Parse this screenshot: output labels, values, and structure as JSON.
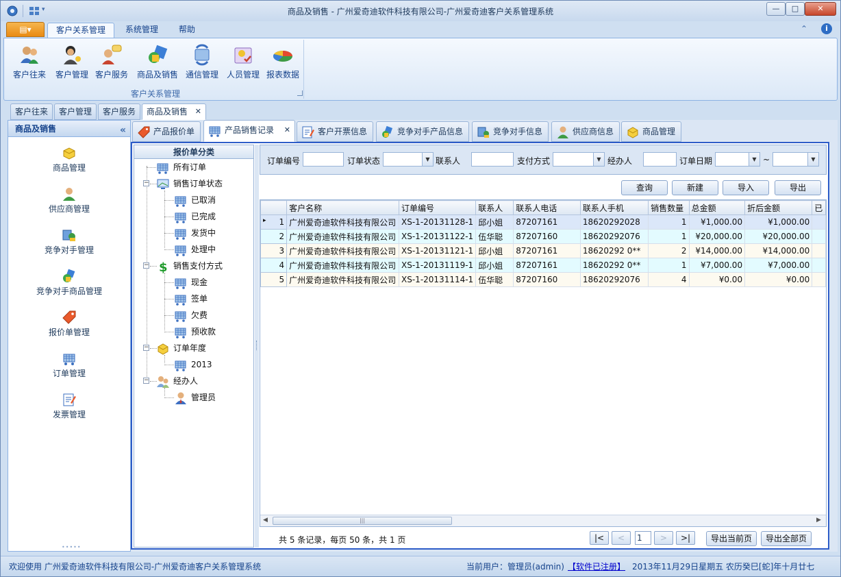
{
  "window": {
    "title": "商品及销售 - 广州爱奇迪软件科技有限公司-广州爱奇迪客户关系管理系统",
    "minimize": "—",
    "maximize": "□",
    "close": "✕"
  },
  "ribbon": {
    "app_menu": "▤▾",
    "tabs": [
      "客户关系管理",
      "系统管理",
      "帮助"
    ],
    "buttons": [
      "客户往来",
      "客户管理",
      "客户服务",
      "商品及销售",
      "通信管理",
      "人员管理",
      "报表数据"
    ],
    "group_label": "客户关系管理",
    "right_icons": [
      "⌃",
      "i"
    ]
  },
  "doc_tabs": [
    "客户往来",
    "客户管理",
    "客户服务",
    "商品及销售"
  ],
  "doc_close": "✕",
  "nav": {
    "title": "商品及销售",
    "collapse": "«",
    "items": [
      "商品管理",
      "供应商管理",
      "竞争对手管理",
      "竞争对手商品管理",
      "报价单管理",
      "订单管理",
      "发票管理"
    ],
    "grip": "•••••"
  },
  "inner_tabs": [
    "产品报价单",
    "产品销售记录",
    "客户开票信息",
    "竞争对手产品信息",
    "竞争对手信息",
    "供应商信息",
    "商品管理"
  ],
  "inner_close": "✕",
  "tree": {
    "title": "报价单分类",
    "nodes": {
      "all": "所有订单",
      "status": "销售订单状态",
      "s1": "已取消",
      "s2": "已完成",
      "s3": "发货中",
      "s4": "处理中",
      "pay": "销售支付方式",
      "p1": "现金",
      "p2": "签单",
      "p3": "欠费",
      "p4": "预收款",
      "year": "订单年度",
      "y1": "2013",
      "handler": "经办人",
      "h1": "管理员"
    },
    "minus": "−"
  },
  "filter": {
    "order_no": "订单编号",
    "order_status": "订单状态",
    "contact": "联系人",
    "pay_method": "支付方式",
    "handler": "经办人",
    "order_date": "订单日期",
    "tilde": "~",
    "arrow": "▼"
  },
  "actions": {
    "query": "查询",
    "new": "新建",
    "import": "导入",
    "export": "导出"
  },
  "grid": {
    "columns": [
      "客户名称",
      "订单编号",
      "联系人",
      "联系人电话",
      "联系人手机",
      "销售数量",
      "总金额",
      "折后金额",
      "已"
    ],
    "current_marker": "▸",
    "rows": [
      {
        "n": "1",
        "name": "广州爱奇迪软件科技有限公司",
        "no": "XS-1-20131128-1",
        "contact": "邱小姐",
        "tel": "87207161",
        "mobile": "18620292028",
        "qty": "1",
        "total": "¥1,000.00",
        "disc": "¥1,000.00"
      },
      {
        "n": "2",
        "name": "广州爱奇迪软件科技有限公司",
        "no": "XS-1-20131122-1",
        "contact": "伍华聪",
        "tel": "87207160",
        "mobile": "18620292076",
        "qty": "1",
        "total": "¥20,000.00",
        "disc": "¥20,000.00"
      },
      {
        "n": "3",
        "name": "广州爱奇迪软件科技有限公司",
        "no": "XS-1-20131121-1",
        "contact": "邱小姐",
        "tel": "87207161",
        "mobile": "18620292 0**",
        "qty": "2",
        "total": "¥14,000.00",
        "disc": "¥14,000.00"
      },
      {
        "n": "4",
        "name": "广州爱奇迪软件科技有限公司",
        "no": "XS-1-20131119-1",
        "contact": "邱小姐",
        "tel": "87207161",
        "mobile": "18620292 0**",
        "qty": "1",
        "total": "¥7,000.00",
        "disc": "¥7,000.00"
      },
      {
        "n": "5",
        "name": "广州爱奇迪软件科技有限公司",
        "no": "XS-1-20131114-1",
        "contact": "伍华聪",
        "tel": "87207160",
        "mobile": "18620292076",
        "qty": "4",
        "total": "¥0.00",
        "disc": "¥0.00"
      }
    ],
    "scroll_left": "◀",
    "scroll_right": "▶",
    "scroll_grip": "|||"
  },
  "pager": {
    "info": "共 5 条记录，每页 50 条，共 1 页",
    "first": "|<",
    "prev": "<",
    "page": "1",
    "next": ">",
    "last": ">|",
    "export_current": "导出当前页",
    "export_all": "导出全部页"
  },
  "status": {
    "welcome": "欢迎使用 广州爱奇迪软件科技有限公司-广州爱奇迪客户关系管理系统",
    "user": "当前用户：管理员(admin)",
    "registered": "【软件已注册】",
    "date": "2013年11月29日星期五 农历癸巳[蛇]年十月廿七"
  },
  "colors": {
    "accent": "#2e5dc8",
    "app_menu": "#e98b12",
    "money_green": "#1e9a2a"
  }
}
